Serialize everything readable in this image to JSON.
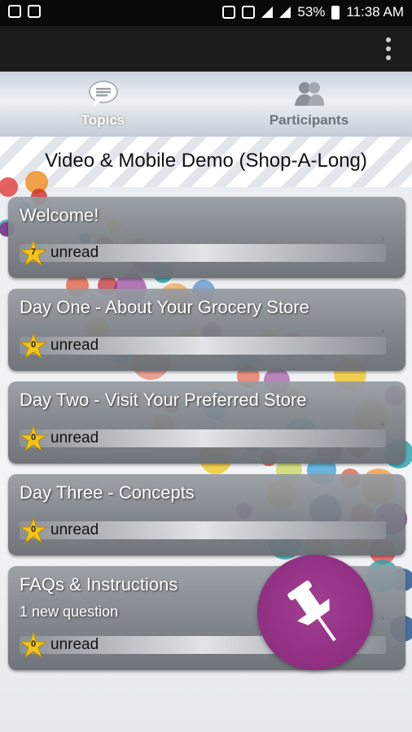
{
  "status_bar": {
    "battery": "53%",
    "time": "11:38 AM"
  },
  "tabs": {
    "topics_label": "Topics",
    "participants_label": "Participants"
  },
  "banner_title": "Video & Mobile Demo (Shop-A-Long)",
  "topics": [
    {
      "title": "Welcome!",
      "subtitle": "",
      "count": "7",
      "unread_label": "unread"
    },
    {
      "title": "Day One - About Your Grocery Store",
      "subtitle": "",
      "count": "0",
      "unread_label": "unread"
    },
    {
      "title": "Day Two - Visit Your Preferred Store",
      "subtitle": "",
      "count": "0",
      "unread_label": "unread"
    },
    {
      "title": "Day Three - Concepts",
      "subtitle": "",
      "count": "0",
      "unread_label": "unread"
    },
    {
      "title": "FAQs & Instructions",
      "subtitle": "1 new question",
      "count": "0",
      "unread_label": "unread"
    }
  ],
  "icons": {
    "overflow": "overflow-menu-icon",
    "topics": "chat-bubble-icon",
    "participants": "people-icon",
    "star": "star-icon",
    "chevron": "chevron-right-icon",
    "fab": "pushpin-icon"
  },
  "colors": {
    "fab": "#8f2f80",
    "star": "#f2c31a",
    "card": "#8a8f96"
  }
}
